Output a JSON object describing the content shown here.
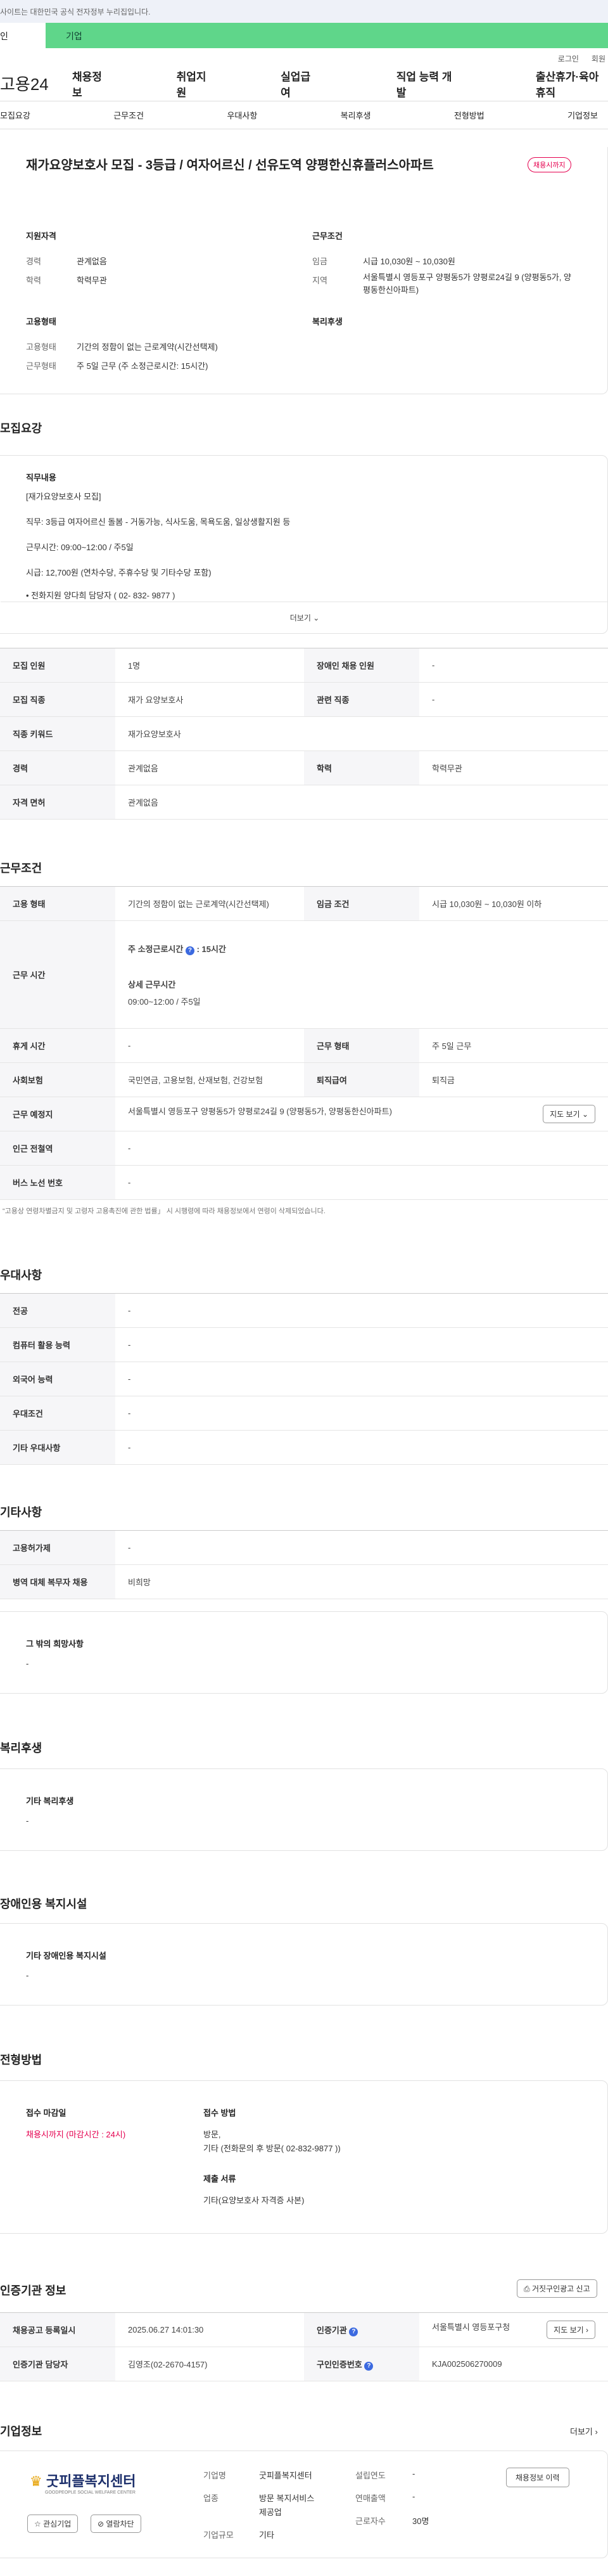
{
  "top": {
    "notice": "사이트는 대한민국 공식 전자정부 누리집입니다.",
    "tab_personal": "인",
    "tab_business": "기업",
    "login": "로그인",
    "join": "회원"
  },
  "gnb": {
    "logo": "고용24",
    "menu": [
      "채용정보",
      "취업지원",
      "실업급여",
      "직업 능력 개발",
      "출산휴가·육아휴직"
    ]
  },
  "snb": [
    "모집요강",
    "근무조건",
    "우대사항",
    "복리후생",
    "전형방법",
    "기업정보"
  ],
  "job": {
    "title": "재가요양보호사 모집 - 3등급 / 여자어르신 / 선유도역 양평한신휴플러스아파트",
    "status": "채용시까지"
  },
  "summary": {
    "qual_h": "지원자격",
    "exp_l": "경력",
    "exp_v": "관계없음",
    "edu_l": "학력",
    "edu_v": "학력무관",
    "work_h": "근무조건",
    "wage_l": "임금",
    "wage_v": "시급 10,030원 ~ 10,030원",
    "region_l": "지역",
    "region_v": "서울특별시 영등포구 양평동5가 양평로24길 9 (양평동5가, 양평동한신아파트)",
    "emp_h": "고용형태",
    "emp1_l": "고용형태",
    "emp1_v": "기간의 정함이 없는 근로계약(시간선택제)",
    "emp2_l": "근무형태",
    "emp2_v": "주 5일 근무 (주 소정근로시간: 15시간)",
    "welfare_h": "복리후생"
  },
  "recruit": {
    "title": "모집요강",
    "content_h": "직무내용",
    "lines": [
      "[재가요양보호사 모집]",
      "직무: 3등급 여자어르신 돌봄 - 거동가능, 식사도움, 목욕도움, 일상생활지원 등",
      "근무시간: 09:00~12:00 / 주5일",
      "시급: 12,700원 (연차수당, 주휴수당 및 기타수당 포함)",
      "• 전화지원 양다희 담당자 ( 02- 832- 9877 )"
    ],
    "more": "더보기",
    "rows": [
      [
        "모집 인원",
        "1명",
        "장애인 채용 인원",
        "-"
      ],
      [
        "모집 직종",
        "재가 요양보호사",
        "관련 직종",
        "-"
      ],
      [
        "직종 키워드",
        "재가요양보호사"
      ],
      [
        "경력",
        "관계없음",
        "학력",
        "학력무관"
      ],
      [
        "자격 면허",
        "관계없음"
      ]
    ]
  },
  "cond": {
    "title": "근무조건",
    "r1": [
      "고용 형태",
      "기간의 정함이 없는 근로계약(시간선택제)",
      "임금 조건",
      "시급 10,030원 ~ 10,030원 이하"
    ],
    "time_l": "근무 시간",
    "weekly_l": "주 소정근로시간",
    "weekly_v": "15시간",
    "detail_l": "상세 근무시간",
    "detail_v": "09:00~12:00 / 주5일",
    "r3": [
      "휴게 시간",
      "-",
      "근무 형태",
      "주 5일 근무"
    ],
    "r4": [
      "사회보험",
      "국민연금, 고용보험, 산재보험, 건강보험",
      "퇴직급여",
      "퇴직금"
    ],
    "loc_l": "근무 예정지",
    "loc_v": "서울특별시 영등포구 양평동5가 양평로24길 9 (양평동5가, 양평동한신아파트)",
    "map": "지도 보기",
    "r6": [
      "인근 전철역",
      "-"
    ],
    "r7": [
      "버스 노선 번호",
      "-"
    ],
    "note": "“고용상 연령차별금지 및 고령자 고용촉진에 관한 법률」 시 시행령에 따라 채용정보에서 연령이 삭제되었습니다."
  },
  "pref": {
    "title": "우대사항",
    "rows": [
      [
        "전공",
        "-"
      ],
      [
        "컴퓨터 활용 능력",
        "-"
      ],
      [
        "외국어 능력",
        "-"
      ],
      [
        "우대조건",
        "-"
      ],
      [
        "기타 우대사항",
        "-"
      ]
    ]
  },
  "etc": {
    "title": "기타사항",
    "rows": [
      [
        "고용허가제",
        "-"
      ],
      [
        "병역 대체 복무자 채용",
        "비희망"
      ]
    ],
    "hope_h": "그 밖의 희망사항",
    "hope_v": "-"
  },
  "welfare": {
    "title": "복리후생",
    "h": "기타 복리후생",
    "v": "-"
  },
  "disab": {
    "title": "장애인용 복지시설",
    "h": "기타 장애인용 복지시설",
    "v": "-"
  },
  "proc": {
    "title": "전형방법",
    "deadline_h": "접수 마감일",
    "deadline_v": "채용시까지 (마감시간 : 24시)",
    "method_h": "접수 방법",
    "method_v1": "방문,",
    "method_v2": "기타 (전화문의 후 방문( 02-832-9877 ))",
    "docs_h": "제출 서류",
    "docs_v": "기타(요양보호사 자격증 사본)"
  },
  "cert": {
    "title": "인증기관 정보",
    "report": "거짓구인광고 신고",
    "r1": [
      "채용공고 등록일시",
      "2025.06.27 14:01:30",
      "인증기관",
      "서울특별시 영등포구청"
    ],
    "map": "지도 보기",
    "r2": [
      "인증기관 담당자",
      "김영조(02-2670-4157)",
      "구인인증번호",
      "KJA002506270009"
    ]
  },
  "company": {
    "title": "기업정보",
    "more": "더보기",
    "logo": "굿피플복지센터",
    "logo_en": "GOODPEOPLE SOCIAL WELFARE CENTER",
    "interest": "관심기업",
    "block": "열람차단",
    "name_l": "기업명",
    "name_v": "굿피플복지센터",
    "ind_l": "업종",
    "ind_v": [
      "방문 복지서비스",
      "제공업"
    ],
    "size_l": "기업규모",
    "size_v": "기타",
    "year_l": "설립연도",
    "year_v": "-",
    "sales_l": "연매출액",
    "sales_v": "-",
    "emp_l": "근로자수",
    "emp_v": "30명",
    "jobs": "채용정보 이력"
  }
}
